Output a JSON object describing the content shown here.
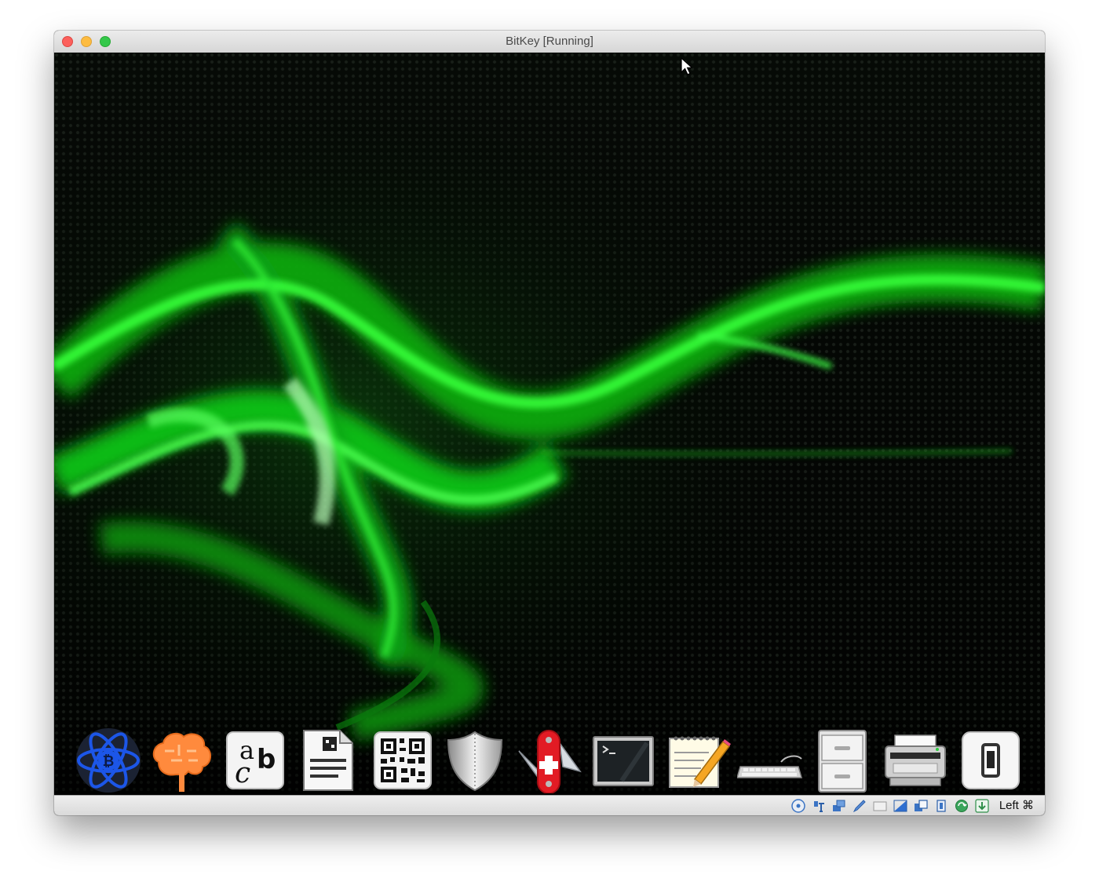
{
  "window": {
    "title": "BitKey [Running]",
    "controls": [
      "close",
      "minimize",
      "zoom"
    ]
  },
  "colors": {
    "accent_green": "#1fff2a",
    "close": "#fc605c",
    "minimize": "#fdbc40",
    "zoom": "#34c84a"
  },
  "dock": {
    "items": [
      {
        "icon": "electrum-bitcoin-icon"
      },
      {
        "icon": "brain-wallet-icon"
      },
      {
        "icon": "abc-font-icon"
      },
      {
        "icon": "qr-document-icon"
      },
      {
        "icon": "qr-code-icon"
      },
      {
        "icon": "shield-icon"
      },
      {
        "icon": "swiss-knife-icon"
      },
      {
        "icon": "terminal-icon"
      },
      {
        "icon": "text-editor-icon"
      },
      {
        "icon": "keyboard-icon"
      },
      {
        "icon": "file-cabinet-icon"
      },
      {
        "icon": "printer-icon"
      },
      {
        "icon": "toggle-switch-icon"
      }
    ]
  },
  "statusbar": {
    "icons": [
      "optical-drive-icon",
      "usb-icon",
      "network-icon",
      "shared-folders-icon",
      "display-icon",
      "screen-icon",
      "capture-icon",
      "cpu-icon",
      "refresh-icon",
      "download-arrow-icon"
    ],
    "host_key": "Left ⌘"
  }
}
